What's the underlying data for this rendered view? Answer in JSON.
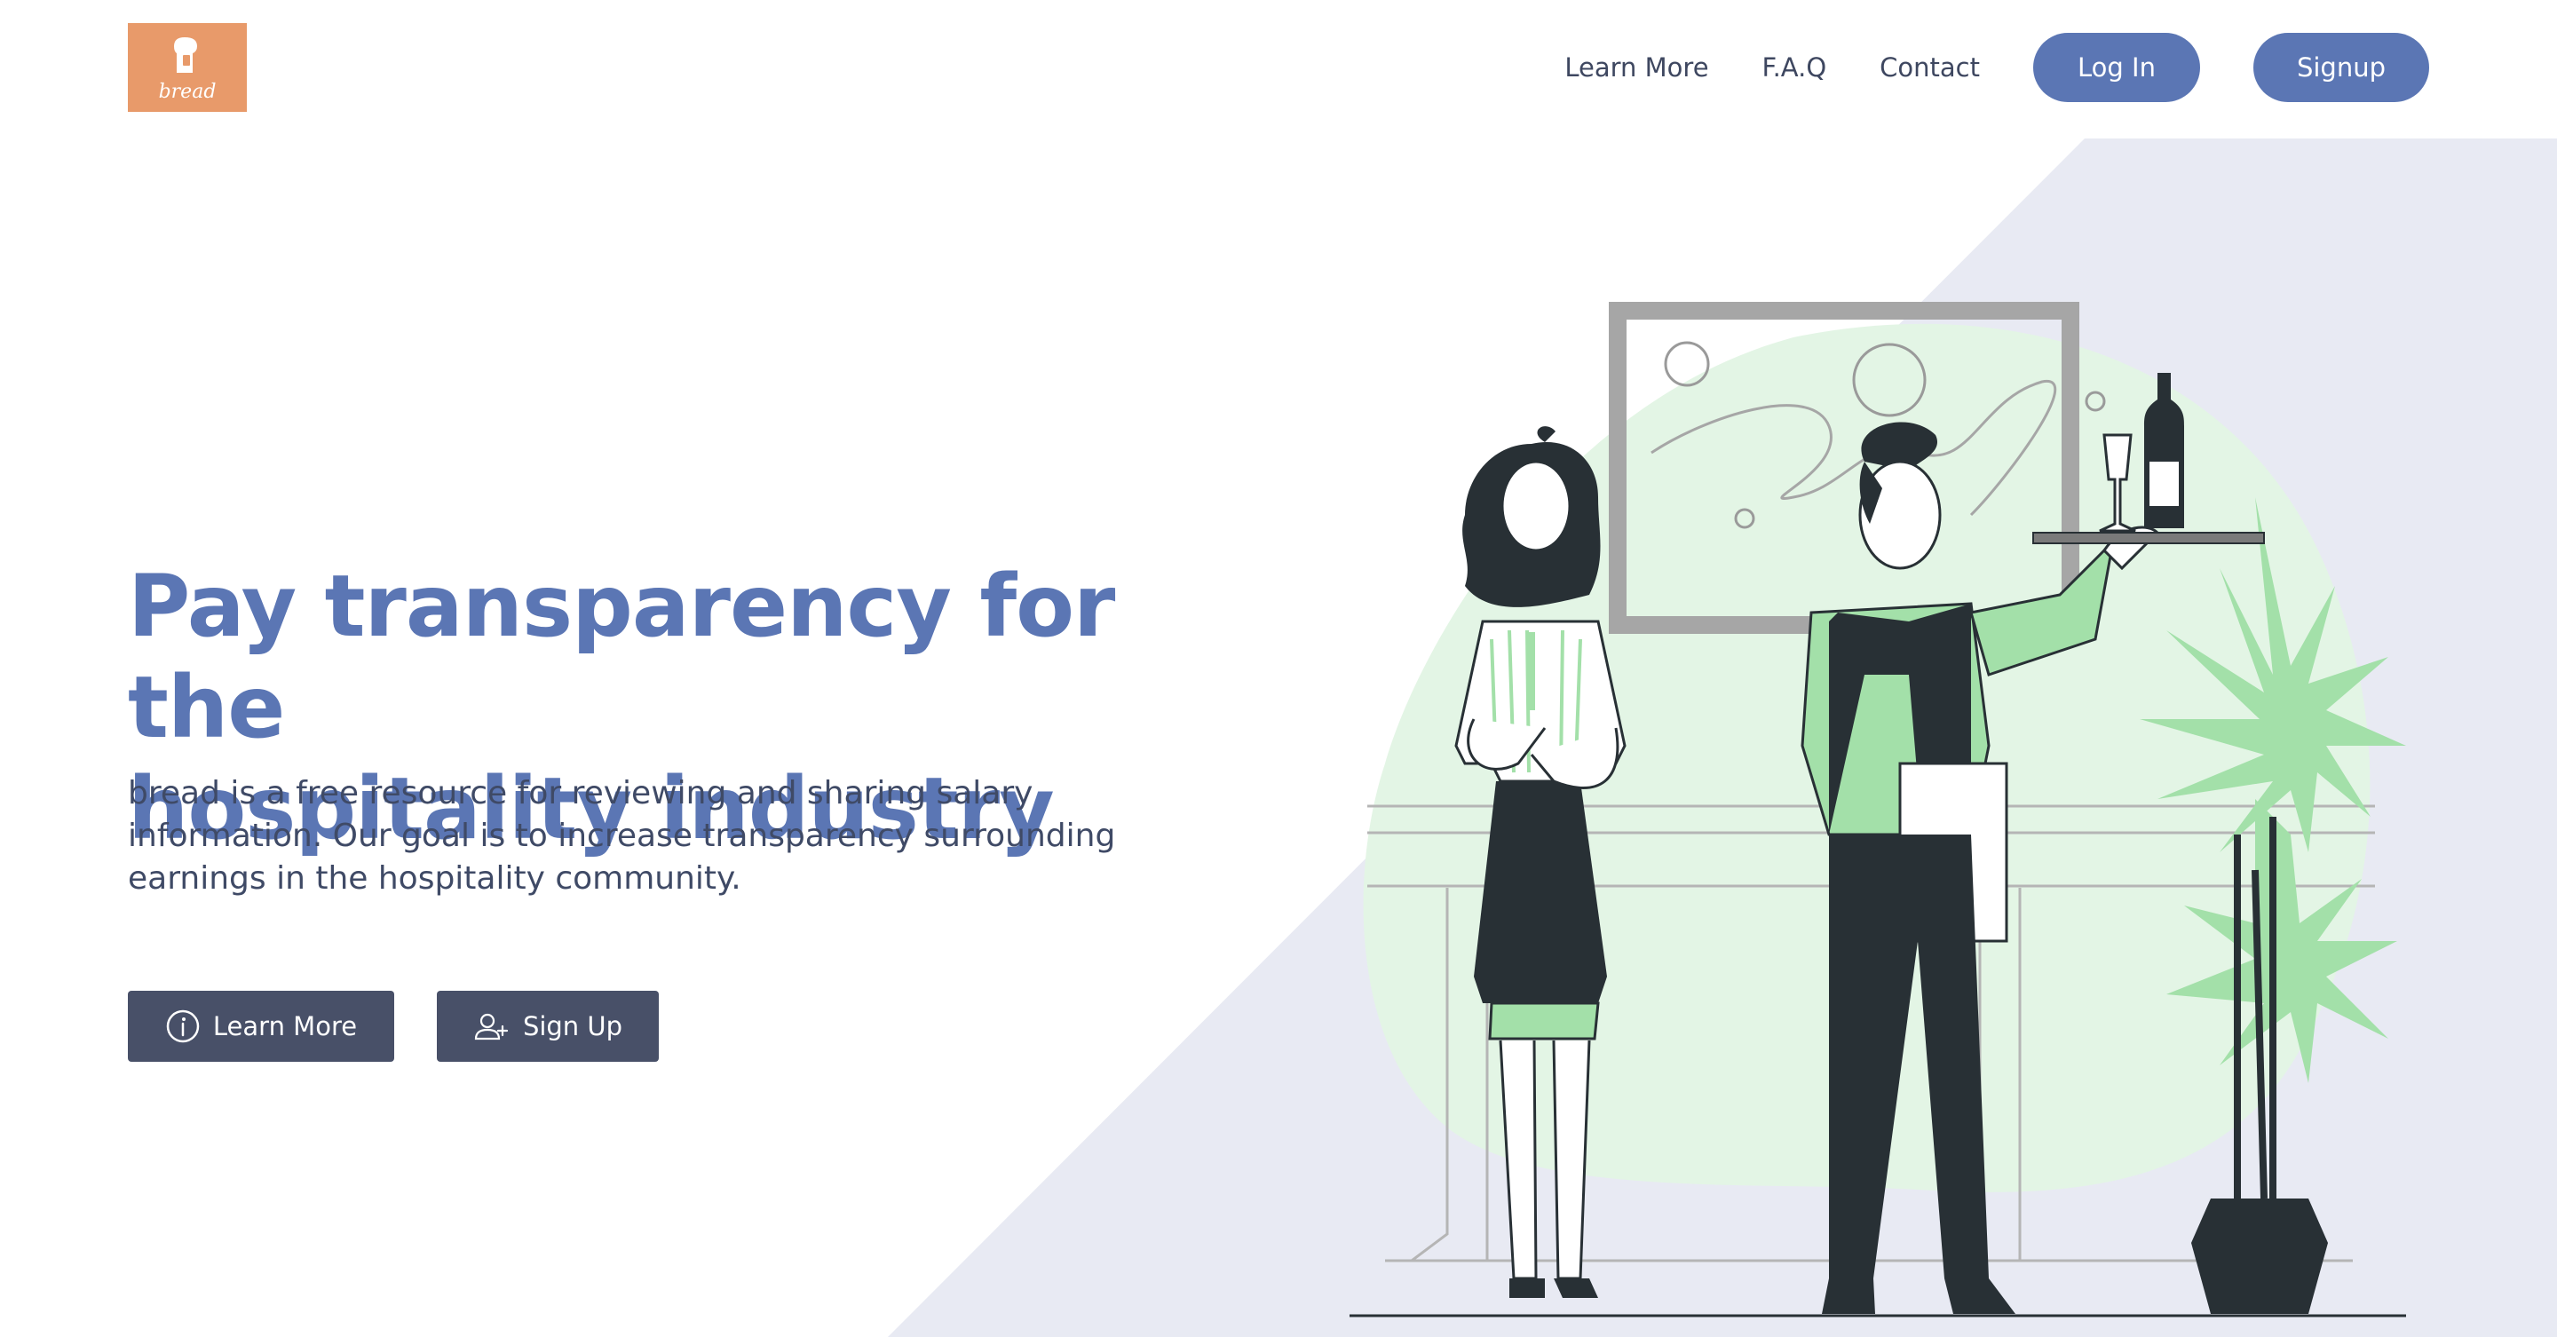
{
  "brand": {
    "logo_text": "bread",
    "logo_color": "#e89a6a",
    "logo_icon": "bread-icon"
  },
  "nav": {
    "links": [
      "Learn More",
      "F.A.Q",
      "Contact"
    ],
    "login_label": "Log In",
    "signup_label": "Signup"
  },
  "hero": {
    "title_line1": "Pay transparency for the",
    "title_line2": "hospitality industry",
    "desc_line1": "bread is a free resource for reviewing and sharing salary",
    "desc_line2": "information. Our goal is to increase transparency surrounding",
    "desc_line3": "earnings in the hospitality community.",
    "learn_more_label": "Learn More",
    "learn_more_icon": "info-icon",
    "sign_up_label": "Sign Up",
    "sign_up_icon": "add-user-icon"
  },
  "colors": {
    "accent": "#5b76b4",
    "button_dark": "#485068",
    "bg_tint": "#e8eaf3",
    "green": "#a3e0a9",
    "green_light": "#e3f5e5",
    "ink": "#283035"
  }
}
